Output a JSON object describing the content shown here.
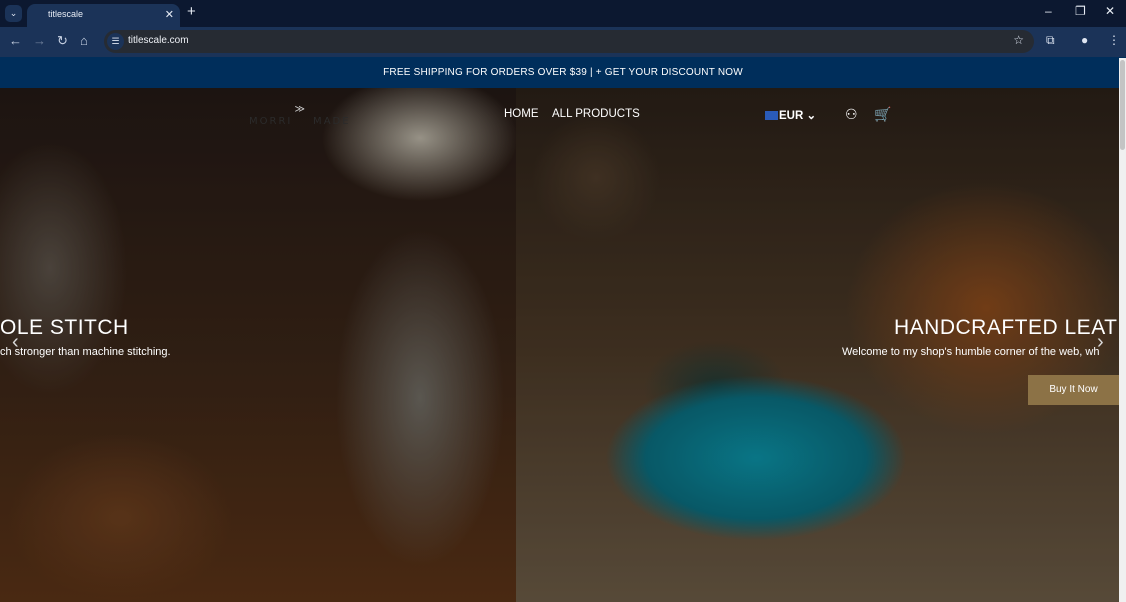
{
  "browser": {
    "tab_title": "titlescale",
    "url": "titlescale.com"
  },
  "announcement": "FREE SHIPPING FOR ORDERS OVER $39 | + GET YOUR DISCOUNT NOW",
  "header": {
    "logo": "MORRIS MADE",
    "nav": [
      "HOME",
      "ALL PRODUCTS"
    ],
    "currency": "EUR"
  },
  "slides": [
    {
      "title": "OLE STITCH",
      "subtitle": "ch stronger than machine stitching."
    },
    {
      "title": "HANDCRAFTED LEAT",
      "subtitle": "Welcome to my shop's humble corner of the web, wh",
      "button": "Buy It Now"
    }
  ],
  "colors": {
    "announcement_bg": "#002e5b",
    "button_bg": "#8c7246"
  }
}
